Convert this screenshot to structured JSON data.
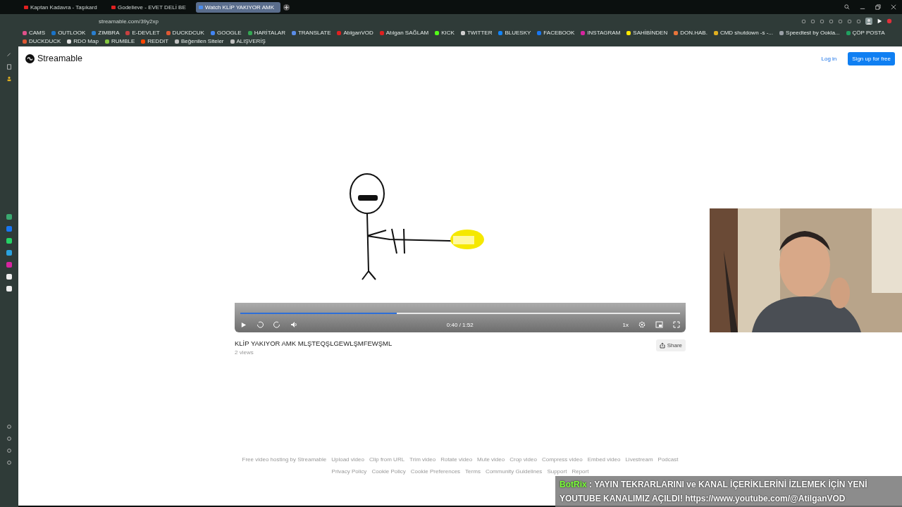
{
  "browser": {
    "tabs": [
      {
        "title": "Kaptan Kadavra - Taşıkard",
        "selected": false
      },
      {
        "title": "Godelieve - EVET DELİ BE",
        "selected": false
      },
      {
        "title": "Watch KLİP YAKIYOR AMK",
        "selected": true
      }
    ],
    "url": "streamable.com/39y2xp",
    "bookmarks": [
      {
        "label": "CAMS",
        "color": "#e0508a"
      },
      {
        "label": "OUTLOOK",
        "color": "#1a73c8"
      },
      {
        "label": "ZIMBRA",
        "color": "#2a7fd0"
      },
      {
        "label": "E-DEVLET",
        "color": "#c84040"
      },
      {
        "label": "DUCKDCUK",
        "color": "#de5833"
      },
      {
        "label": "GOOGLE",
        "color": "#4285f4"
      },
      {
        "label": "HARİTALAR",
        "color": "#34a853"
      },
      {
        "label": "TRANSLATE",
        "color": "#5a8de8"
      },
      {
        "label": "AtılganVOD",
        "color": "#e02020"
      },
      {
        "label": "Atılgan SAĞLAM",
        "color": "#e02020"
      },
      {
        "label": "KICK",
        "color": "#53fc18"
      },
      {
        "label": "TWITTER",
        "color": "#d0d0d0"
      },
      {
        "label": "BLUESKY",
        "color": "#1185fe"
      },
      {
        "label": "FACEBOOK",
        "color": "#1877f2"
      },
      {
        "label": "INSTAGRAM",
        "color": "#d6249f"
      },
      {
        "label": "SAHİBİNDEN",
        "color": "#ffe800"
      },
      {
        "label": "DON.HAB.",
        "color": "#e8743a"
      },
      {
        "label": "CMD shutdown -s -...",
        "color": "#e0b020"
      },
      {
        "label": "Speedtest by Ookla...",
        "color": "#9aa0a6"
      },
      {
        "label": "ÇÖP POSTA",
        "color": "#20a060"
      },
      {
        "label": "DUCKDUCK",
        "color": "#de5833"
      },
      {
        "label": "RDO Map",
        "color": "#e0e0e0"
      },
      {
        "label": "RUMBLE",
        "color": "#85c742"
      },
      {
        "label": "REDDIT",
        "color": "#ff4500"
      },
      {
        "label": "Beğenilen Siteler",
        "color": "#c0c0c0"
      },
      {
        "label": "ALIŞVERİŞ",
        "color": "#c0c0c0"
      }
    ]
  },
  "page": {
    "brand": "Streamable",
    "login": "Log in",
    "signup": "Sign up for free",
    "player": {
      "level": 0.355,
      "time": "0:40 / 1:52",
      "speed": "1x"
    },
    "video_title": "KLİP YAKIYOR AMK MLŞTEQŞLGEWLŞMFEWŞML",
    "views": "2 views",
    "share": "Share",
    "footer_links": [
      "Free video hosting by Streamable",
      "Upload video",
      "Clip from URL",
      "Trim video",
      "Rotate video",
      "Mute video",
      "Crop video",
      "Compress video",
      "Embed video",
      "Livestream",
      "Podcast"
    ],
    "footer_legal": [
      "Privacy Policy",
      "Cookie Policy",
      "Cookie Preferences",
      "Terms",
      "Community Guidelines",
      "Support",
      "Report"
    ]
  },
  "chat_overlay": {
    "user": "BotRix",
    "message": ": YAYIN TEKRARLARINI ve KANAL İÇERİKLERİNİ İZLEMEK İÇİN YENİ YOUTUBE KANALIMIZ AÇILDI! https://www.youtube.com/@AtilganVOD"
  }
}
